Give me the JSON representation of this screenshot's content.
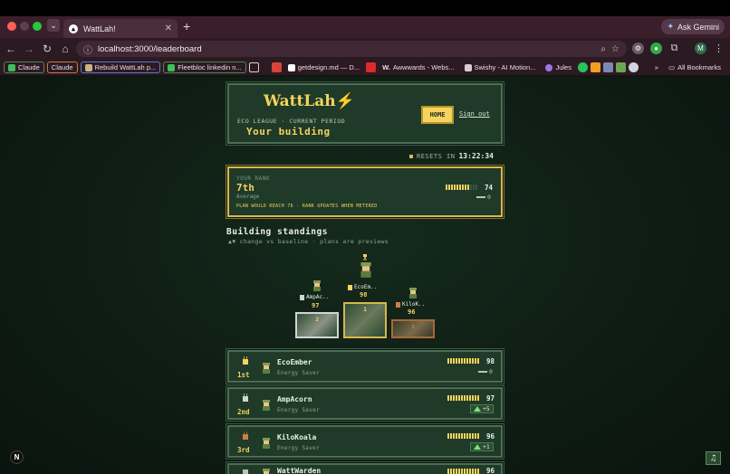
{
  "browser": {
    "tab_title": "WattLah!",
    "new_tab": "+",
    "gemini_label": "Ask Gemini",
    "url": "localhost:3000/leaderboard",
    "profile_initial": "M",
    "bookmarks": [
      {
        "label": "Claude",
        "style": "chip-green"
      },
      {
        "label": "Claude",
        "style": "chip-orange"
      },
      {
        "label": "Rebuild WattLah p...",
        "style": "chip-blue"
      },
      {
        "label": "Fleetbloc linkedin n...",
        "style": "chip-green"
      },
      {
        "label": "getdesign.md — D...",
        "style": "plain"
      },
      {
        "label": "Awwwards - Webs...",
        "style": "plain"
      },
      {
        "label": "Swishy - AI Motion...",
        "style": "plain"
      },
      {
        "label": "Jules",
        "style": "plain"
      }
    ],
    "all_bookmarks": "All Bookmarks",
    "chevrons": "»"
  },
  "header": {
    "logo": "WattLah⚡",
    "eyebrow": "ECO LEAGUE · CURRENT PERIOD",
    "building": "Your building",
    "home_label": "HOME",
    "signout_label": "Sign out"
  },
  "resets": {
    "label": "RESETS IN",
    "time": "13:22:34"
  },
  "rank": {
    "label": "YOUR RANK",
    "value": "7th",
    "sub": "Average",
    "score": "74",
    "meter_fraction": 0.74,
    "delta": "0",
    "note": "PLAN WOULD REACH 76 · RANK UPDATES WHEN METERED"
  },
  "standings": {
    "title": "Building standings",
    "subtitle": "▲▼ change vs baseline · plans are previews"
  },
  "podium": [
    {
      "place": "2",
      "name": "AmpAc..",
      "score": "97"
    },
    {
      "place": "1",
      "name": "EcoEm..",
      "score": "98"
    },
    {
      "place": "3",
      "name": "KiloK..",
      "score": "96"
    }
  ],
  "rows": [
    {
      "place": "1st",
      "name": "EcoEmber",
      "tier": "Energy Saver",
      "score": "98",
      "meter_fraction": 0.98,
      "delta": "0",
      "delta_dir": "flat"
    },
    {
      "place": "2nd",
      "name": "AmpAcorn",
      "tier": "Energy Saver",
      "score": "97",
      "meter_fraction": 0.97,
      "delta": "+5",
      "delta_dir": "up"
    },
    {
      "place": "3rd",
      "name": "KiloKoala",
      "tier": "Energy Saver",
      "score": "96",
      "meter_fraction": 0.96,
      "delta": "+1",
      "delta_dir": "up"
    },
    {
      "place": "",
      "name": "WattWarden",
      "tier": "",
      "score": "96",
      "meter_fraction": 0.96,
      "delta": "",
      "delta_dir": "none"
    }
  ],
  "floating": {
    "next_badge": "N",
    "music_icon": "♫"
  },
  "colors": {
    "accent": "#f4d35e",
    "panel": "#1f3a28",
    "border": "#4c6e55",
    "up": "#7fe07a"
  }
}
